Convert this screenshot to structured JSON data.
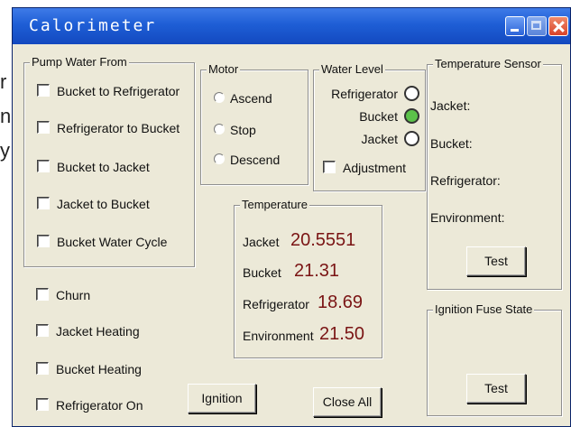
{
  "background_text": [
    "r",
    "n",
    "y"
  ],
  "window": {
    "title": "Calorimeter",
    "titlebar_color": "#1e5ed6"
  },
  "pump": {
    "legend": "Pump Water From",
    "options": [
      {
        "label": "Bucket to Refrigerator",
        "checked": false
      },
      {
        "label": "Refrigerator to Bucket",
        "checked": false
      },
      {
        "label": "Bucket  to Jacket",
        "checked": false
      },
      {
        "label": "Jacket to Bucket",
        "checked": false
      },
      {
        "label": "Bucket Water Cycle",
        "checked": false
      }
    ]
  },
  "misc_checks": [
    {
      "label": "Churn",
      "checked": false
    },
    {
      "label": "Jacket Heating",
      "checked": false
    },
    {
      "label": "Bucket Heating",
      "checked": false
    },
    {
      "label": "Refrigerator On",
      "checked": false
    }
  ],
  "motor": {
    "legend": "Motor",
    "options": [
      "Ascend",
      "Stop",
      "Descend"
    ]
  },
  "water_level": {
    "legend": "Water Level",
    "items": [
      {
        "label": "Refrigerator",
        "color": "#ffffff"
      },
      {
        "label": "Bucket",
        "color": "#5cc24a"
      },
      {
        "label": "Jacket",
        "color": "#ffffff"
      }
    ],
    "adjustment": "Adjustment"
  },
  "temperature": {
    "legend": "Temperature",
    "value_color": "#7a1414",
    "rows": [
      {
        "label": "Jacket",
        "value": "20.5551"
      },
      {
        "label": "Bucket",
        "value": "21.31"
      },
      {
        "label": "Refrigerator",
        "value": "18.69"
      },
      {
        "label": "Environment",
        "value": "21.50"
      }
    ]
  },
  "sensor": {
    "legend": "Temperature Sensor",
    "rows": [
      "Jacket:",
      "Bucket:",
      "Refrigerator:",
      "Environment:"
    ],
    "test_label": "Test"
  },
  "fuse": {
    "legend": "Ignition Fuse State",
    "test_label": "Test"
  },
  "buttons": {
    "ignition": "Ignition",
    "close_all": "Close All"
  }
}
